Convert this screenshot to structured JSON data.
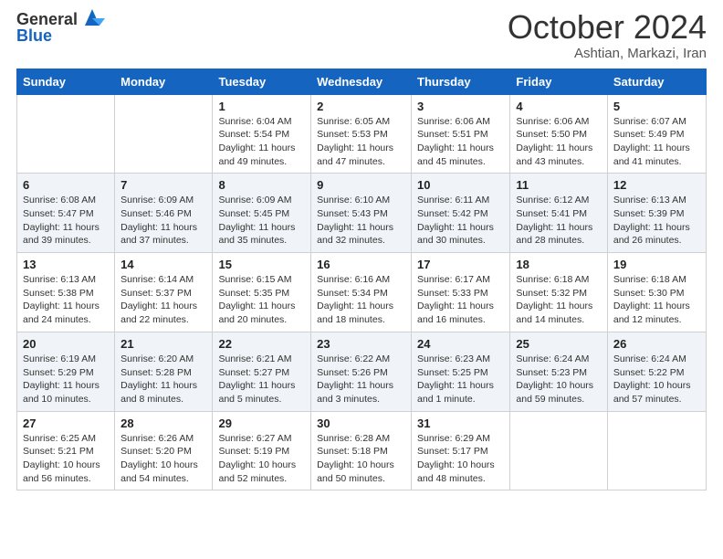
{
  "header": {
    "logo_general": "General",
    "logo_blue": "Blue",
    "month_title": "October 2024",
    "subtitle": "Ashtian, Markazi, Iran"
  },
  "weekdays": [
    "Sunday",
    "Monday",
    "Tuesday",
    "Wednesday",
    "Thursday",
    "Friday",
    "Saturday"
  ],
  "weeks": [
    [
      {
        "day": "",
        "detail": ""
      },
      {
        "day": "",
        "detail": ""
      },
      {
        "day": "1",
        "detail": "Sunrise: 6:04 AM\nSunset: 5:54 PM\nDaylight: 11 hours and 49 minutes."
      },
      {
        "day": "2",
        "detail": "Sunrise: 6:05 AM\nSunset: 5:53 PM\nDaylight: 11 hours and 47 minutes."
      },
      {
        "day": "3",
        "detail": "Sunrise: 6:06 AM\nSunset: 5:51 PM\nDaylight: 11 hours and 45 minutes."
      },
      {
        "day": "4",
        "detail": "Sunrise: 6:06 AM\nSunset: 5:50 PM\nDaylight: 11 hours and 43 minutes."
      },
      {
        "day": "5",
        "detail": "Sunrise: 6:07 AM\nSunset: 5:49 PM\nDaylight: 11 hours and 41 minutes."
      }
    ],
    [
      {
        "day": "6",
        "detail": "Sunrise: 6:08 AM\nSunset: 5:47 PM\nDaylight: 11 hours and 39 minutes."
      },
      {
        "day": "7",
        "detail": "Sunrise: 6:09 AM\nSunset: 5:46 PM\nDaylight: 11 hours and 37 minutes."
      },
      {
        "day": "8",
        "detail": "Sunrise: 6:09 AM\nSunset: 5:45 PM\nDaylight: 11 hours and 35 minutes."
      },
      {
        "day": "9",
        "detail": "Sunrise: 6:10 AM\nSunset: 5:43 PM\nDaylight: 11 hours and 32 minutes."
      },
      {
        "day": "10",
        "detail": "Sunrise: 6:11 AM\nSunset: 5:42 PM\nDaylight: 11 hours and 30 minutes."
      },
      {
        "day": "11",
        "detail": "Sunrise: 6:12 AM\nSunset: 5:41 PM\nDaylight: 11 hours and 28 minutes."
      },
      {
        "day": "12",
        "detail": "Sunrise: 6:13 AM\nSunset: 5:39 PM\nDaylight: 11 hours and 26 minutes."
      }
    ],
    [
      {
        "day": "13",
        "detail": "Sunrise: 6:13 AM\nSunset: 5:38 PM\nDaylight: 11 hours and 24 minutes."
      },
      {
        "day": "14",
        "detail": "Sunrise: 6:14 AM\nSunset: 5:37 PM\nDaylight: 11 hours and 22 minutes."
      },
      {
        "day": "15",
        "detail": "Sunrise: 6:15 AM\nSunset: 5:35 PM\nDaylight: 11 hours and 20 minutes."
      },
      {
        "day": "16",
        "detail": "Sunrise: 6:16 AM\nSunset: 5:34 PM\nDaylight: 11 hours and 18 minutes."
      },
      {
        "day": "17",
        "detail": "Sunrise: 6:17 AM\nSunset: 5:33 PM\nDaylight: 11 hours and 16 minutes."
      },
      {
        "day": "18",
        "detail": "Sunrise: 6:18 AM\nSunset: 5:32 PM\nDaylight: 11 hours and 14 minutes."
      },
      {
        "day": "19",
        "detail": "Sunrise: 6:18 AM\nSunset: 5:30 PM\nDaylight: 11 hours and 12 minutes."
      }
    ],
    [
      {
        "day": "20",
        "detail": "Sunrise: 6:19 AM\nSunset: 5:29 PM\nDaylight: 11 hours and 10 minutes."
      },
      {
        "day": "21",
        "detail": "Sunrise: 6:20 AM\nSunset: 5:28 PM\nDaylight: 11 hours and 8 minutes."
      },
      {
        "day": "22",
        "detail": "Sunrise: 6:21 AM\nSunset: 5:27 PM\nDaylight: 11 hours and 5 minutes."
      },
      {
        "day": "23",
        "detail": "Sunrise: 6:22 AM\nSunset: 5:26 PM\nDaylight: 11 hours and 3 minutes."
      },
      {
        "day": "24",
        "detail": "Sunrise: 6:23 AM\nSunset: 5:25 PM\nDaylight: 11 hours and 1 minute."
      },
      {
        "day": "25",
        "detail": "Sunrise: 6:24 AM\nSunset: 5:23 PM\nDaylight: 10 hours and 59 minutes."
      },
      {
        "day": "26",
        "detail": "Sunrise: 6:24 AM\nSunset: 5:22 PM\nDaylight: 10 hours and 57 minutes."
      }
    ],
    [
      {
        "day": "27",
        "detail": "Sunrise: 6:25 AM\nSunset: 5:21 PM\nDaylight: 10 hours and 56 minutes."
      },
      {
        "day": "28",
        "detail": "Sunrise: 6:26 AM\nSunset: 5:20 PM\nDaylight: 10 hours and 54 minutes."
      },
      {
        "day": "29",
        "detail": "Sunrise: 6:27 AM\nSunset: 5:19 PM\nDaylight: 10 hours and 52 minutes."
      },
      {
        "day": "30",
        "detail": "Sunrise: 6:28 AM\nSunset: 5:18 PM\nDaylight: 10 hours and 50 minutes."
      },
      {
        "day": "31",
        "detail": "Sunrise: 6:29 AM\nSunset: 5:17 PM\nDaylight: 10 hours and 48 minutes."
      },
      {
        "day": "",
        "detail": ""
      },
      {
        "day": "",
        "detail": ""
      }
    ]
  ]
}
